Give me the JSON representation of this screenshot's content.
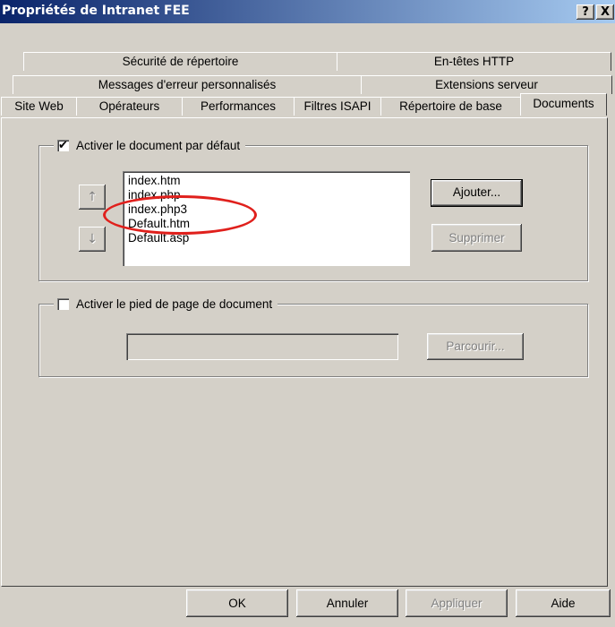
{
  "window": {
    "title": "Propriétés de Intranet FEE",
    "help_glyph": "?",
    "close_glyph": "X"
  },
  "tabs": {
    "row1": [
      "Sécurité de répertoire",
      "En-têtes HTTP"
    ],
    "row2": [
      "Messages d'erreur personnalisés",
      "Extensions serveur"
    ],
    "row3": [
      "Site Web",
      "Opérateurs",
      "Performances",
      "Filtres ISAPI",
      "Répertoire de base",
      "Documents"
    ],
    "active": "Documents"
  },
  "default_doc": {
    "checkbox_label": "Activer le document par défaut",
    "checked": true,
    "check_glyph": "✔",
    "documents": [
      "index.htm",
      "index.php",
      "index.php3",
      "Default.htm",
      "Default.asp"
    ],
    "up_arrow": "↑",
    "down_arrow": "↓",
    "add_label": "Ajouter...",
    "remove_label": "Supprimer"
  },
  "footer_doc": {
    "checkbox_label": "Activer le pied de page de document",
    "checked": false,
    "path_value": "",
    "browse_label": "Parcourir..."
  },
  "buttons": {
    "ok": "OK",
    "cancel": "Annuler",
    "apply": "Appliquer",
    "help": "Aide"
  },
  "annotation": {
    "color": "#e0201c"
  }
}
